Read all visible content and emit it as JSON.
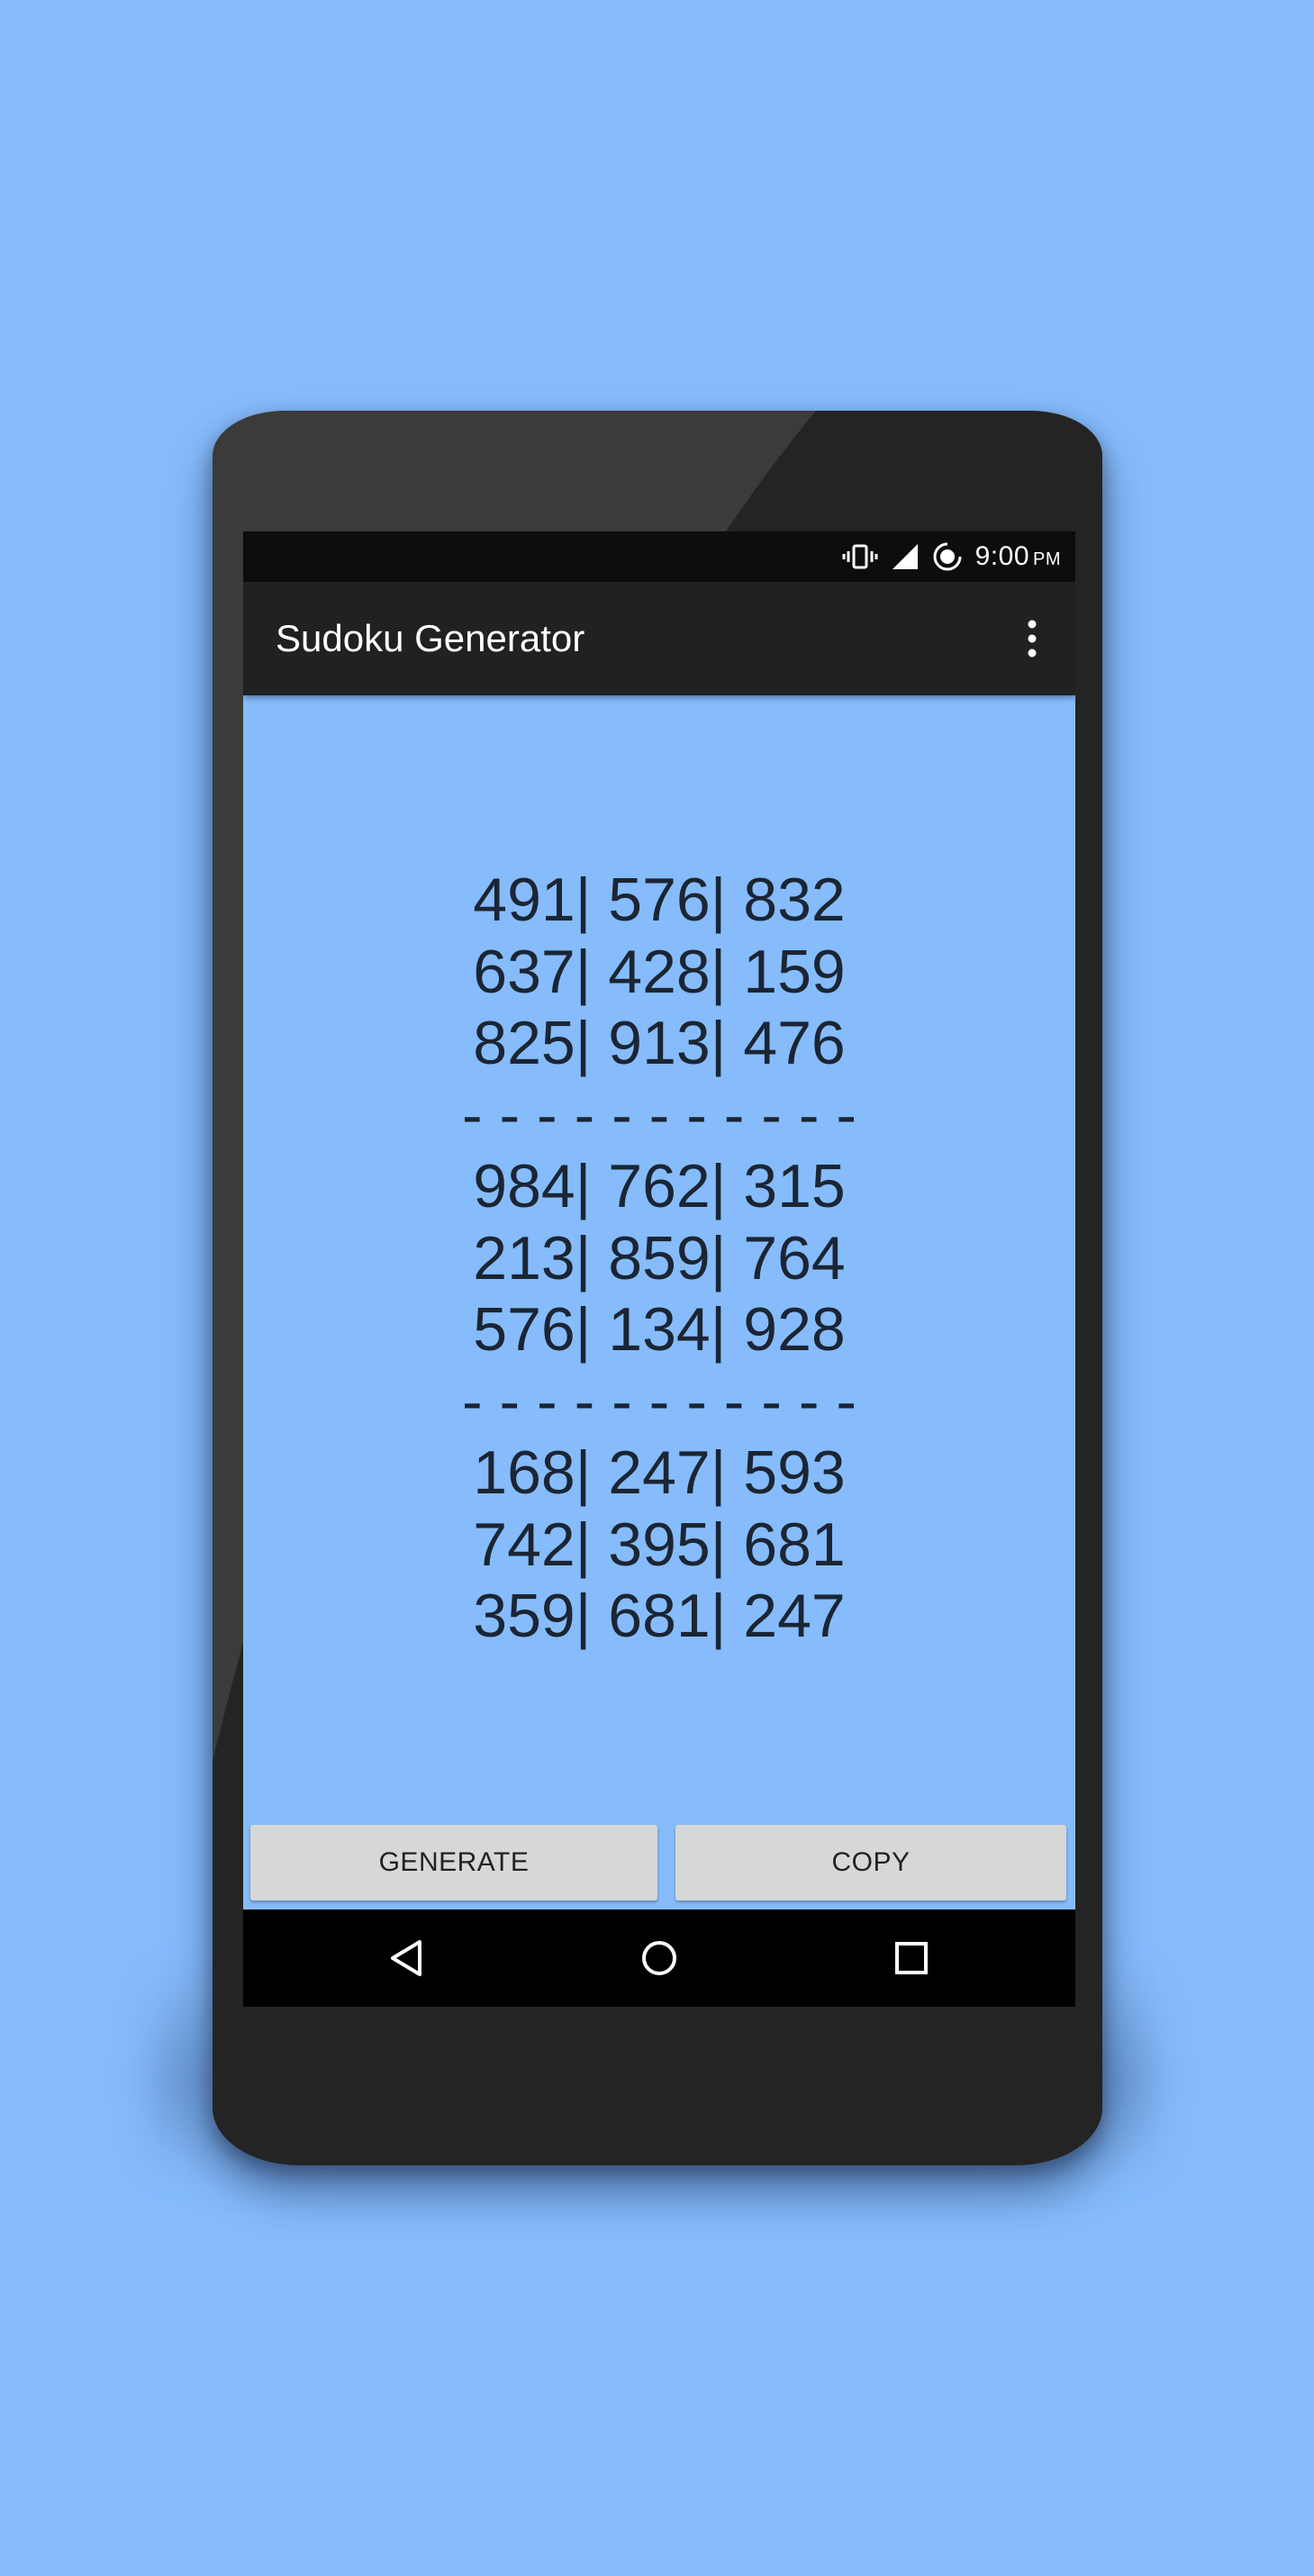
{
  "status_bar": {
    "time": "9:00",
    "ampm": "PM",
    "icons": [
      "vibrate-icon",
      "signal-icon",
      "data-saver-icon"
    ]
  },
  "app_bar": {
    "title": "Sudoku Generator",
    "menu_icon": "overflow-menu-icon"
  },
  "puzzle": {
    "rows": [
      "491| 576| 832",
      "637| 428| 159",
      "825| 913| 476",
      "- - - - - - - - - - -",
      "984| 762| 315",
      "213| 859| 764",
      "576| 134| 928",
      "- - - - - - - - - - -",
      "168| 247| 593",
      "742| 395| 681",
      "359| 681| 247"
    ]
  },
  "buttons": {
    "generate": "GENERATE",
    "copy": "COPY"
  },
  "nav_bar": {
    "back_icon": "back-icon",
    "home_icon": "home-icon",
    "recents_icon": "recents-icon"
  },
  "colors": {
    "background": "#86bcfc",
    "app_bar": "#212121",
    "status_bar": "#0d0d0d",
    "button": "#d6d7d7",
    "text": "#1b2533"
  }
}
